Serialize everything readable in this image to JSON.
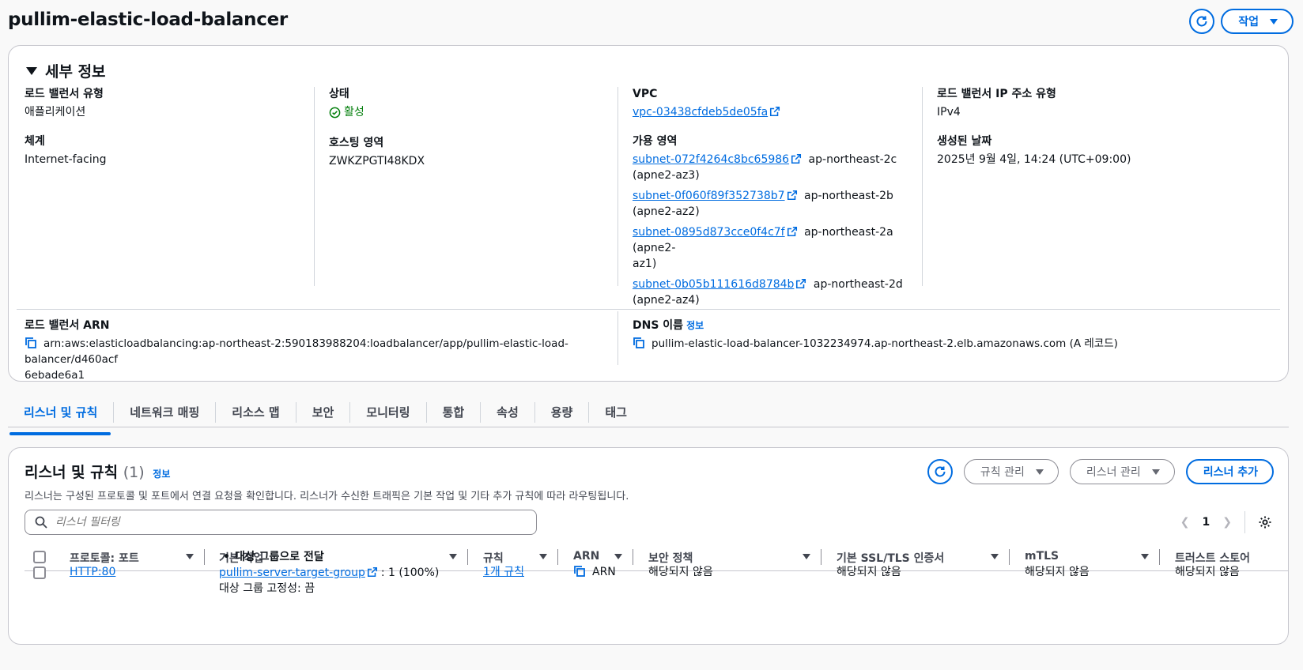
{
  "page": {
    "title": "pullim-elastic-load-balancer",
    "actions_label": "작업"
  },
  "details": {
    "section_title": "세부 정보",
    "lb_type_label": "로드 밸런서 유형",
    "lb_type_value": "애플리케이션",
    "scheme_label": "체계",
    "scheme_value": "Internet-facing",
    "status_label": "상태",
    "status_value": "활성",
    "hosted_zone_label": "호스팅 영역",
    "hosted_zone_value": "ZWKZPGTI48KDX",
    "vpc_label": "VPC",
    "vpc_value": "vpc-03438cfdeb5de05fa",
    "az_label": "가용 영역",
    "subnets": [
      {
        "id": "subnet-072f4264c8bc65986",
        "zone": "ap-northeast-2c",
        "zone2": "(apne2-az3)"
      },
      {
        "id": "subnet-0f060f89f352738b7",
        "zone": "ap-northeast-2b",
        "zone2": "(apne2-az2)"
      },
      {
        "id": "subnet-0895d873cce0f4c7f",
        "zone": "ap-northeast-2a (apne2-",
        "zone2": "az1)"
      },
      {
        "id": "subnet-0b05b111616d8784b",
        "zone": "ap-northeast-2d",
        "zone2": "(apne2-az4)"
      }
    ],
    "ip_type_label": "로드 밸런서 IP 주소 유형",
    "ip_type_value": "IPv4",
    "created_label": "생성된 날짜",
    "created_value": "2025년 9월 4일, 14:24 (UTC+09:00)",
    "arn_label": "로드 밸런서 ARN",
    "arn_line1": "arn:aws:elasticloadbalancing:ap-northeast-2:590183988204:loadbalancer/app/pullim-elastic-load-balancer/d460acf",
    "arn_line2": "6ebade6a1",
    "dns_label": "DNS 이름",
    "dns_info": "정보",
    "dns_value": "pullim-elastic-load-balancer-1032234974.ap-northeast-2.elb.amazonaws.com (A 레코드)"
  },
  "tabs": [
    "리스너 및 규칙",
    "네트워크 매핑",
    "리소스 맵",
    "보안",
    "모니터링",
    "통합",
    "속성",
    "용량",
    "태그"
  ],
  "listeners": {
    "title": "리스너 및 규칙",
    "count": "(1)",
    "info": "정보",
    "description": "리스너는 구성된 프로토콜 및 포트에서 연결 요청을 확인합니다. 리스너가 수신한 트래픽은 기본 작업 및 기타 추가 규칙에 따라 라우팅됩니다.",
    "manage_rules": "규칙 관리",
    "manage_listener": "리스너 관리",
    "add_listener": "리스너 추가",
    "filter_placeholder": "리스너 필터링",
    "page": "1",
    "columns": [
      "프로토콜: 포트",
      "기본 작업",
      "규칙",
      "ARN",
      "보안 정책",
      "기본 SSL/TLS 인증서",
      "mTLS",
      "트러스트 스토어"
    ],
    "row": {
      "protocol": "HTTP:80",
      "action_title": "대상 그룹으로 전달",
      "target_group": "pullim-server-target-group",
      "weight": ": 1 (100%)",
      "stickiness": "대상 그룹 고정성: 끔",
      "rules": "1개 규칙",
      "arn": "ARN",
      "security_policy": "해당되지 않음",
      "ssl_cert": "해당되지 않음",
      "mtls": "해당되지 않음",
      "trust_store": "해당되지 않음"
    }
  }
}
